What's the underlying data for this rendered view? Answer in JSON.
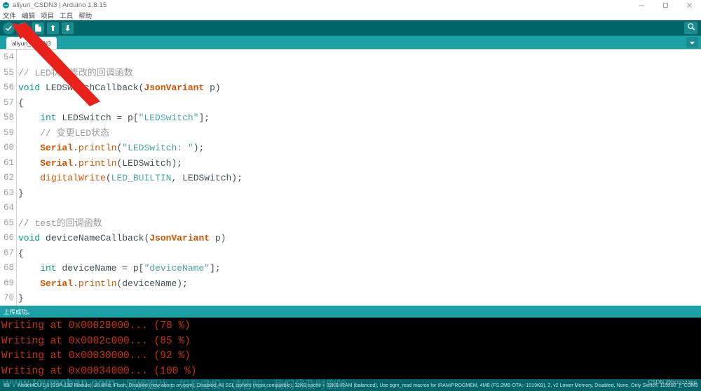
{
  "window": {
    "title": "aliyun_CSDN3 | Arduino 1.8.15",
    "logo_icon": "arduino-logo-icon",
    "controls": [
      {
        "name": "minimize",
        "icon": "minimize-icon"
      },
      {
        "name": "maximize",
        "icon": "maximize-icon"
      },
      {
        "name": "close",
        "icon": "close-icon"
      }
    ]
  },
  "menubar": {
    "items": [
      {
        "label": "文件"
      },
      {
        "label": "编辑"
      },
      {
        "label": "项目"
      },
      {
        "label": "工具"
      },
      {
        "label": "帮助"
      }
    ]
  },
  "toolbar": {
    "buttons": [
      {
        "name": "verify-button",
        "icon": "check-icon",
        "tooltip": "验证"
      },
      {
        "name": "upload-button",
        "icon": "arrow-right-icon",
        "tooltip": "上传"
      },
      {
        "name": "new-button",
        "icon": "page-icon",
        "tooltip": "新建"
      },
      {
        "name": "open-button",
        "icon": "arrow-up-icon",
        "tooltip": "打开"
      },
      {
        "name": "save-button",
        "icon": "arrow-down-icon",
        "tooltip": "保存"
      }
    ],
    "serial_monitor": {
      "name": "serial-monitor-button",
      "icon": "magnifier-icon"
    }
  },
  "tabbar": {
    "tabs": [
      {
        "label": "aliyun_CSDN3",
        "active": true
      }
    ],
    "dropdown_icon": "chevron-down-icon"
  },
  "editor": {
    "first_line_number": 54,
    "lines": [
      {
        "n": 54,
        "tokens": []
      },
      {
        "n": 55,
        "tokens": [
          {
            "t": "comment",
            "s": "// LED状态修改的回调函数"
          }
        ]
      },
      {
        "n": 56,
        "tokens": [
          {
            "t": "kw",
            "s": "void"
          },
          {
            "t": "plain",
            "s": " LEDSwitchCallback("
          },
          {
            "t": "type",
            "s": "JsonVariant"
          },
          {
            "t": "plain",
            "s": " p)"
          }
        ]
      },
      {
        "n": 57,
        "tokens": [
          {
            "t": "plain",
            "s": "{"
          }
        ]
      },
      {
        "n": 58,
        "tokens": [
          {
            "t": "plain",
            "s": "    "
          },
          {
            "t": "kw",
            "s": "int"
          },
          {
            "t": "plain",
            "s": " LEDSwitch = p["
          },
          {
            "t": "str",
            "s": "\"LEDSwitch\""
          },
          {
            "t": "plain",
            "s": "];"
          }
        ]
      },
      {
        "n": 59,
        "tokens": [
          {
            "t": "plain",
            "s": "    "
          },
          {
            "t": "comment",
            "s": "// 变更LED状态"
          }
        ]
      },
      {
        "n": 60,
        "tokens": [
          {
            "t": "plain",
            "s": "    "
          },
          {
            "t": "obj",
            "s": "Serial"
          },
          {
            "t": "plain",
            "s": "."
          },
          {
            "t": "fn",
            "s": "println"
          },
          {
            "t": "plain",
            "s": "("
          },
          {
            "t": "str",
            "s": "\"LEDSwitch: \""
          },
          {
            "t": "plain",
            "s": ");"
          }
        ]
      },
      {
        "n": 61,
        "tokens": [
          {
            "t": "plain",
            "s": "    "
          },
          {
            "t": "obj",
            "s": "Serial"
          },
          {
            "t": "plain",
            "s": "."
          },
          {
            "t": "fn",
            "s": "println"
          },
          {
            "t": "plain",
            "s": "(LEDSwitch);"
          }
        ]
      },
      {
        "n": 62,
        "tokens": [
          {
            "t": "plain",
            "s": "    "
          },
          {
            "t": "fn",
            "s": "digitalWrite"
          },
          {
            "t": "plain",
            "s": "("
          },
          {
            "t": "const",
            "s": "LED_BUILTIN"
          },
          {
            "t": "plain",
            "s": ", LEDSwitch);"
          }
        ]
      },
      {
        "n": 63,
        "tokens": [
          {
            "t": "plain",
            "s": "}"
          }
        ]
      },
      {
        "n": 64,
        "tokens": []
      },
      {
        "n": 65,
        "tokens": [
          {
            "t": "comment",
            "s": "// test的回调函数"
          }
        ]
      },
      {
        "n": 66,
        "tokens": [
          {
            "t": "kw",
            "s": "void"
          },
          {
            "t": "plain",
            "s": " deviceNameCallback("
          },
          {
            "t": "type",
            "s": "JsonVariant"
          },
          {
            "t": "plain",
            "s": " p)"
          }
        ]
      },
      {
        "n": 67,
        "tokens": [
          {
            "t": "plain",
            "s": "{"
          }
        ]
      },
      {
        "n": 68,
        "tokens": [
          {
            "t": "plain",
            "s": "    "
          },
          {
            "t": "kw",
            "s": "int"
          },
          {
            "t": "plain",
            "s": " deviceName = p["
          },
          {
            "t": "str",
            "s": "\"deviceName\""
          },
          {
            "t": "plain",
            "s": "];"
          }
        ]
      },
      {
        "n": 69,
        "tokens": [
          {
            "t": "plain",
            "s": "    "
          },
          {
            "t": "obj",
            "s": "Serial"
          },
          {
            "t": "plain",
            "s": "."
          },
          {
            "t": "fn",
            "s": "println"
          },
          {
            "t": "plain",
            "s": "(deviceName);"
          }
        ]
      },
      {
        "n": 70,
        "tokens": [
          {
            "t": "plain",
            "s": "}"
          }
        ]
      }
    ]
  },
  "status_message": {
    "text": "上传成功。"
  },
  "console": {
    "lines": [
      "Writing at 0x00028000... (78 %)",
      "Writing at 0x0002c000... (85 %)",
      "Writing at 0x00030000... (92 %)",
      "Writing at 0x00034000... (100 %)"
    ],
    "text_color": "#cc3300",
    "background": "#000000"
  },
  "board_bar": {
    "line_number": "68",
    "board_info": "NodeMCU 1.0 (ESP-12E Module), 80 MHz, Flash, Disabled (new aborts on oom), Disabled, All SSL ciphers (most compatible), 32KB cache + 32KB IRAM (balanced), Use pgm_read macros for IRAM/PROGMEM, 4MB (FS:2MB OTA:~1019KB), 2, v2 Lower Memory, Disabled, None, Only Sketch, 115200 上 COM3"
  },
  "watermarks": {
    "toymoban": "www.toymoban.com",
    "chinese": "网络图片，如有侵权，请告知，我们将及时删除",
    "csdn": "CSDN @hrzzzzqqq"
  },
  "colors": {
    "toolbar_bg": "#006468",
    "tabbar_bg": "#1aa0a5",
    "accent": "#00979c",
    "keyword": "#00979c",
    "type": "#d35400",
    "string": "#4aa3a8",
    "comment": "#9a9a9a",
    "console_text": "#cc3300"
  }
}
